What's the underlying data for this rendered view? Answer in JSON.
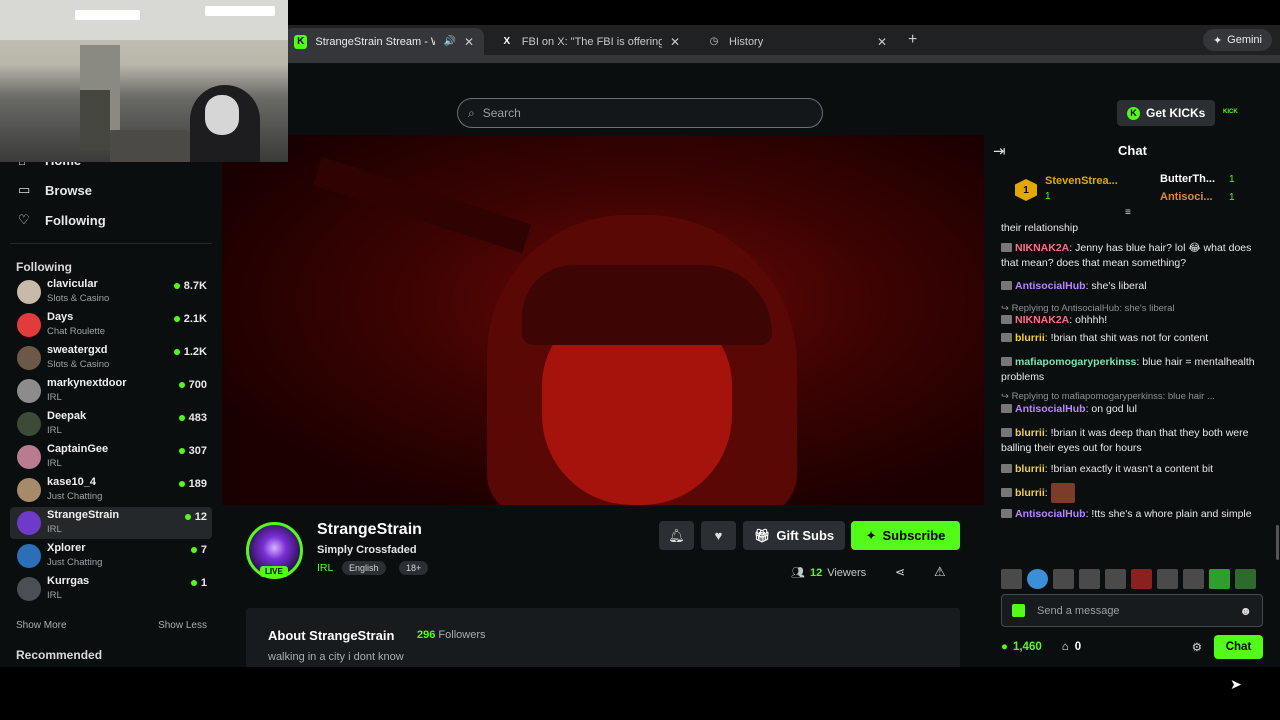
{
  "browser": {
    "tabs": [
      {
        "title": "StrangeStrain Stream - W",
        "favicon": "K",
        "active": true
      },
      {
        "title": "FBI on X: \"The FBI is offering",
        "favicon": "X",
        "active": false
      },
      {
        "title": "History",
        "favicon": "history-icon",
        "active": false
      }
    ],
    "gemini_label": "Gemini"
  },
  "header": {
    "search_placeholder": "Search",
    "get_kicks_label": "Get KICKs"
  },
  "sidebar": {
    "nav": [
      {
        "label": "Home",
        "icon": "home-icon"
      },
      {
        "label": "Browse",
        "icon": "browse-icon"
      },
      {
        "label": "Following",
        "icon": "heart-icon"
      }
    ],
    "following_title": "Following",
    "channels": [
      {
        "name": "clavicular",
        "category": "Slots & Casino",
        "viewers": "8.7K",
        "color": "#c9b9a8"
      },
      {
        "name": "Days",
        "category": "Chat Roulette",
        "viewers": "2.1K",
        "color": "#e23b3b"
      },
      {
        "name": "sweatergxd",
        "category": "Slots & Casino",
        "viewers": "1.2K",
        "color": "#6d5848"
      },
      {
        "name": "markynextdoor",
        "category": "IRL",
        "viewers": "700",
        "color": "#8c8c8c"
      },
      {
        "name": "Deepak",
        "category": "IRL",
        "viewers": "483",
        "color": "#3d4a38"
      },
      {
        "name": "CaptainGee",
        "category": "IRL",
        "viewers": "307",
        "color": "#b97b8f"
      },
      {
        "name": "kase10_4",
        "category": "Just Chatting",
        "viewers": "189",
        "color": "#a68a6a"
      },
      {
        "name": "StrangeStrain",
        "category": "IRL",
        "viewers": "12",
        "color": "#6e3ac9"
      },
      {
        "name": "Xplorer",
        "category": "Just Chatting",
        "viewers": "7",
        "color": "#2b6fb8"
      },
      {
        "name": "Kurrgas",
        "category": "IRL",
        "viewers": "1",
        "color": "#4a4f55"
      }
    ],
    "show_more": "Show More",
    "show_less": "Show Less",
    "recommended_title": "Recommended"
  },
  "stream": {
    "name": "StrangeStrain",
    "title": "Simply Crossfaded",
    "category": "IRL",
    "tags": [
      "English",
      "18+"
    ],
    "live_badge": "LIVE",
    "gift_label": "Gift Subs",
    "subscribe_label": "Subscribe",
    "viewers_count": "12",
    "viewers_label": "Viewers"
  },
  "about": {
    "heading": "About StrangeStrain",
    "followers_count": "296",
    "followers_label": "Followers",
    "bio": "walking in a city i dont know"
  },
  "chat": {
    "title": "Chat",
    "leaderboard": [
      {
        "rank": "1",
        "name": "StevenStrea...",
        "count": "1"
      },
      {
        "name": "ButterTh...",
        "count": "1"
      },
      {
        "name": "Antisoci...",
        "count": "1"
      }
    ],
    "messages": [
      {
        "user": "",
        "text": "their relationship",
        "color": "#e9e9e9"
      },
      {
        "user": "NIKNAK2A",
        "text": ": Jenny has blue hair? lol 😂 what does that mean? does that mean something?",
        "color": "#ff6b8a"
      },
      {
        "user": "AntisocialHub",
        "text": ": she's liberal",
        "color": "#b784ff"
      },
      {
        "reply": "↪ Replying to AntisocialHub: she's liberal"
      },
      {
        "user": "NIKNAK2A",
        "text": ": ohhhh!",
        "color": "#ff6b8a"
      },
      {
        "user": "blurrii",
        "text": ": !brian that shit was not for content",
        "color": "#f4d03f"
      },
      {
        "user": "mafiapomogaryperkinss",
        "text": ": blue hair = mentalhealth problems",
        "color": "#7ee0b0"
      },
      {
        "reply": "↪ Replying to mafiapomogaryperkinss: blue hair ..."
      },
      {
        "user": "AntisocialHub",
        "text": ": on god lul",
        "color": "#b784ff"
      },
      {
        "user": "blurrii",
        "text": ": !brian it was deep than that they both were balling their eyes out for hours",
        "color": "#f4d03f"
      },
      {
        "user": "blurrii",
        "text": ": !brian exactly it wasn't a content bit",
        "color": "#f4d03f"
      },
      {
        "user": "blurrii",
        "text": ":",
        "color": "#f4d03f"
      },
      {
        "user": "AntisocialHub",
        "text": ": !tts she's a whore plain and simple",
        "color": "#b784ff"
      }
    ],
    "input_placeholder": "Send a message",
    "kicks_balance": "1,460",
    "store_count": "0",
    "chat_button": "Chat"
  }
}
